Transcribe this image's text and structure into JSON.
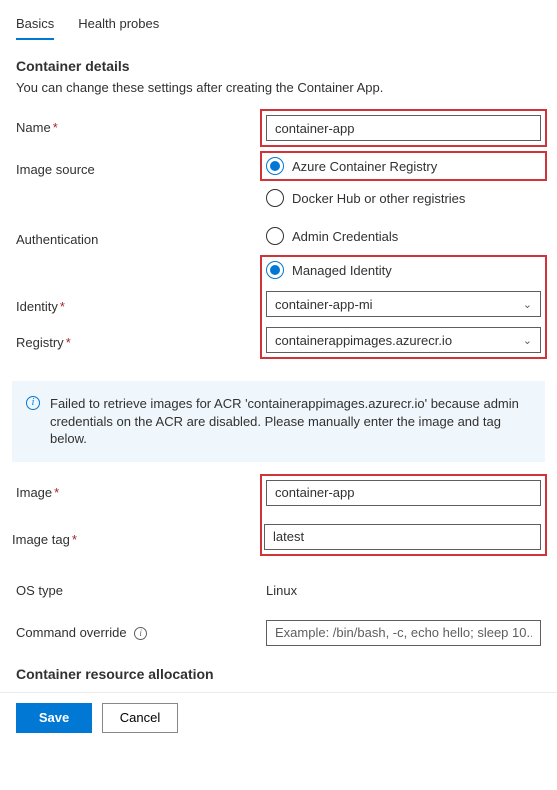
{
  "tabs": [
    {
      "label": "Basics",
      "active": true
    },
    {
      "label": "Health probes",
      "active": false
    }
  ],
  "section": {
    "title": "Container details",
    "description": "You can change these settings after creating the Container App."
  },
  "fields": {
    "name": {
      "label": "Name",
      "required": true,
      "value": "container-app"
    },
    "imageSource": {
      "label": "Image source",
      "options": {
        "acr": "Azure Container Registry",
        "dockerHub": "Docker Hub or other registries"
      },
      "selected": "acr"
    },
    "authentication": {
      "label": "Authentication",
      "options": {
        "admin": "Admin Credentials",
        "managed": "Managed Identity"
      },
      "selected": "managed"
    },
    "identity": {
      "label": "Identity",
      "required": true,
      "value": "container-app-mi"
    },
    "registry": {
      "label": "Registry",
      "required": true,
      "value": "containerappimages.azurecr.io"
    },
    "image": {
      "label": "Image",
      "required": true,
      "value": "container-app"
    },
    "imageTag": {
      "label": "Image tag",
      "required": true,
      "value": "latest"
    },
    "osType": {
      "label": "OS type",
      "value": "Linux"
    },
    "commandOverride": {
      "label": "Command override",
      "placeholder": "Example: /bin/bash, -c, echo hello; sleep 10..."
    }
  },
  "infoMessage": "Failed to retrieve images for ACR 'containerappimages.azurecr.io' because admin credentials on the ACR are disabled. Please manually enter the image and tag below.",
  "resourceSection": {
    "title": "Container resource allocation"
  },
  "footer": {
    "save": "Save",
    "cancel": "Cancel"
  }
}
